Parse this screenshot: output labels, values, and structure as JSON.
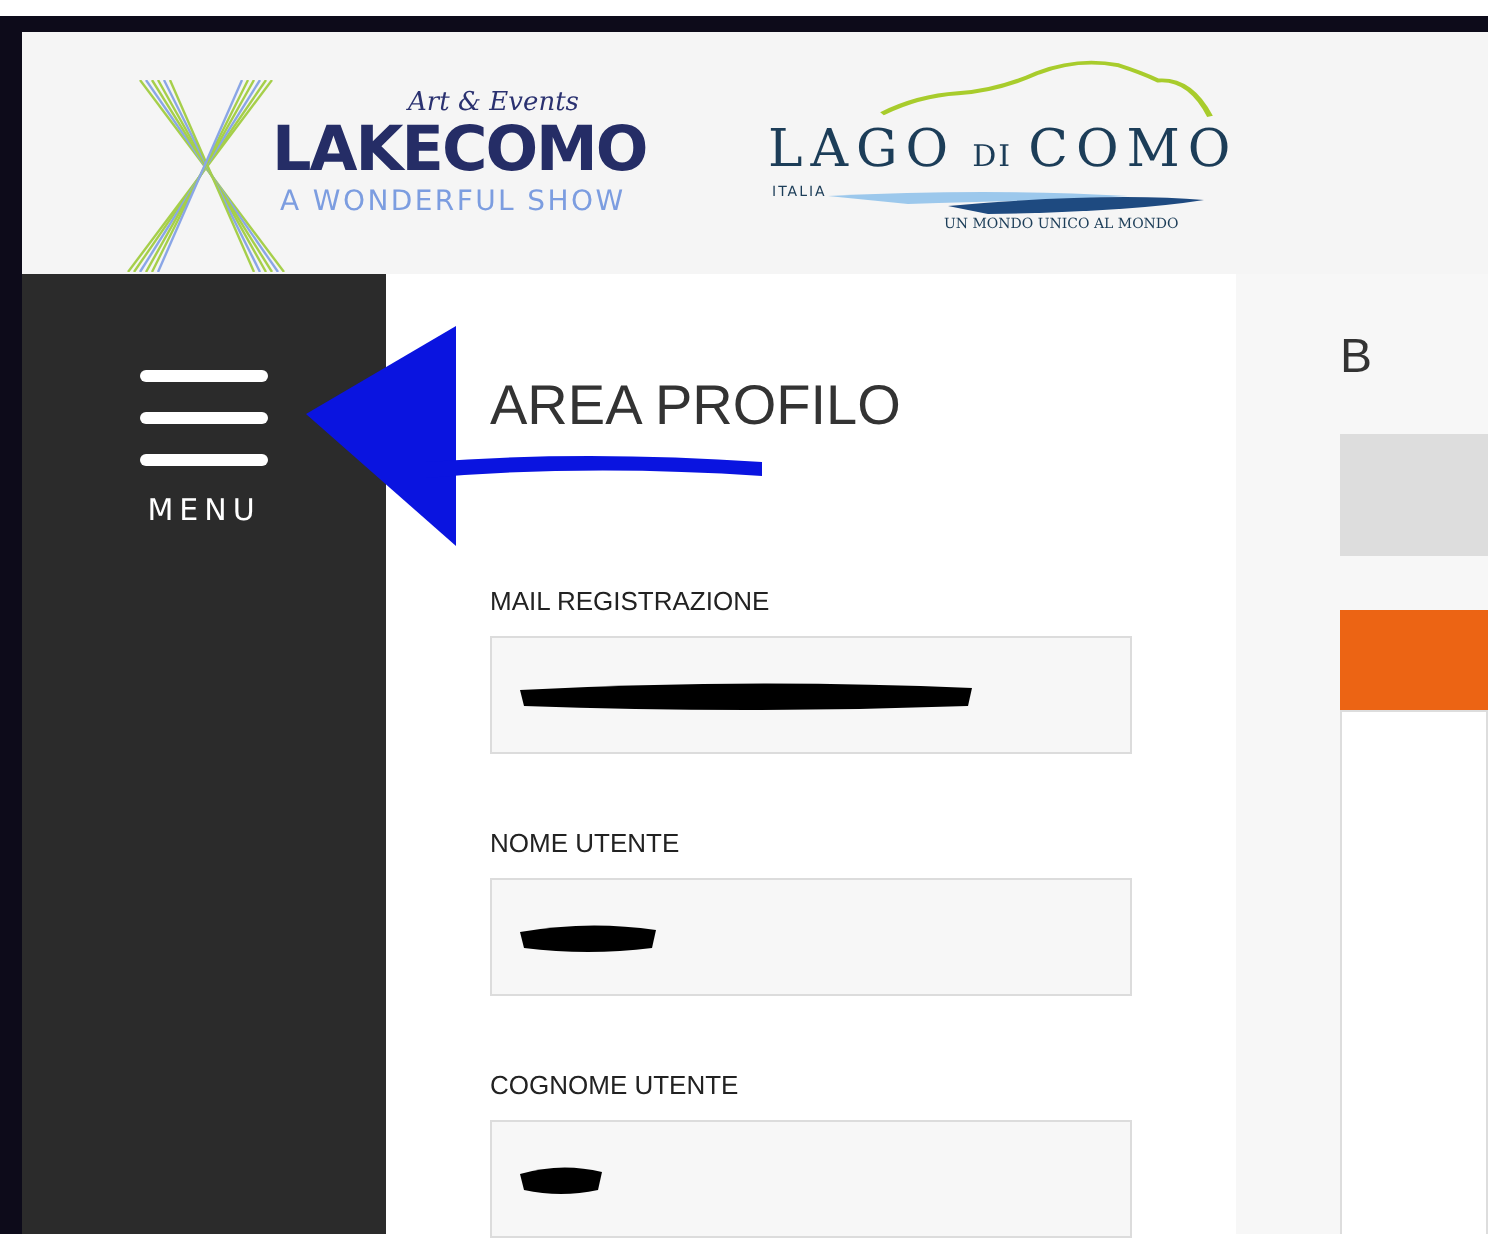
{
  "header": {
    "event_logo": {
      "script_line": "Art & Events",
      "name": "LAKECOMO",
      "subtitle": "A WONDERFUL SHOW"
    },
    "lake_logo": {
      "name_parts": [
        "LAGO",
        "DI",
        "COMO"
      ],
      "country": "ITALIA",
      "motto": "UN MONDO UNICO AL MONDO"
    }
  },
  "sidebar": {
    "menu_label": "MENU"
  },
  "profile": {
    "title": "AREA PROFILO",
    "fields": [
      {
        "label": "MAIL REGISTRAZIONE",
        "redacted": true
      },
      {
        "label": "NOME UTENTE",
        "redacted": true
      },
      {
        "label": "COGNOME UTENTE",
        "redacted": true
      }
    ]
  },
  "side_panel": {
    "heading": "B"
  },
  "annotation": {
    "kind": "arrow"
  }
}
